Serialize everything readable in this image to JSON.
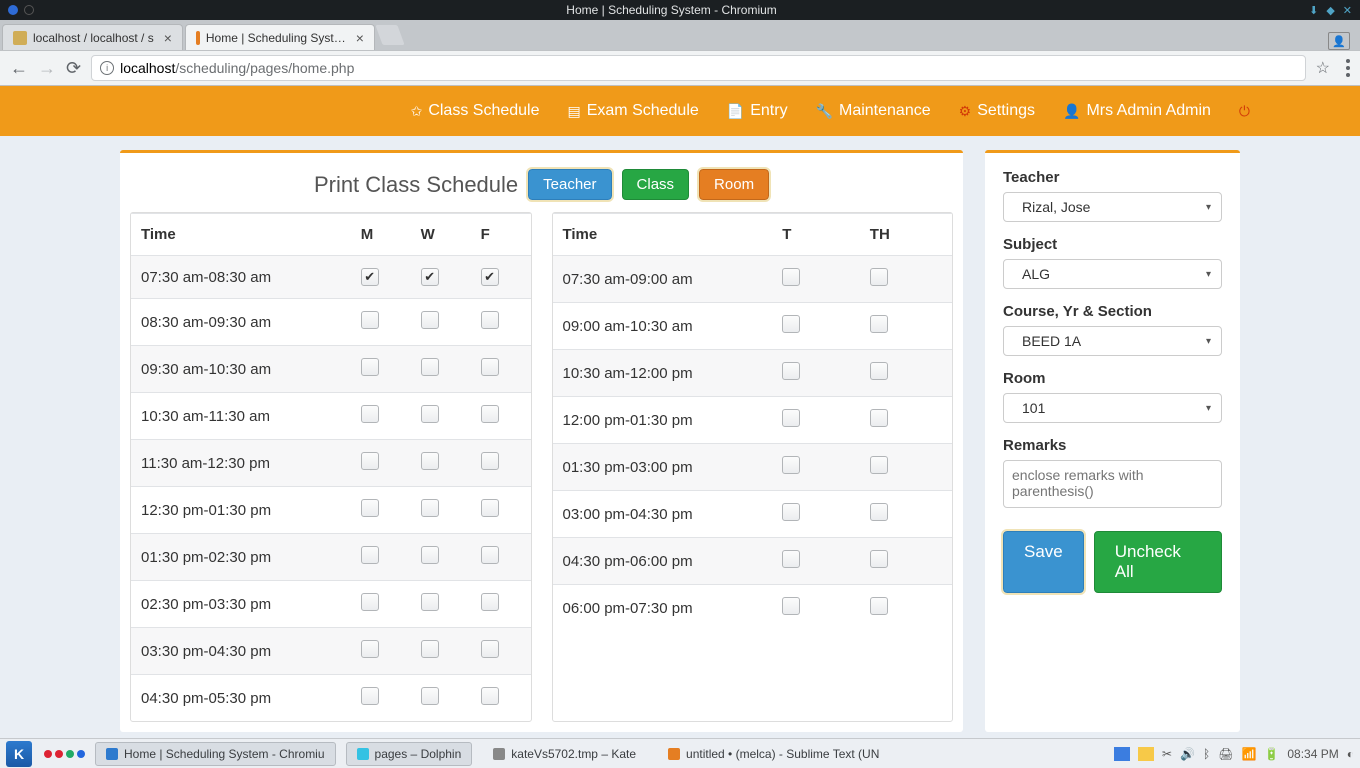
{
  "os_title": "Home | Scheduling System - Chromium",
  "browser_tabs": [
    {
      "title": "localhost / localhost / s"
    },
    {
      "title": "Home | Scheduling Syst…"
    }
  ],
  "url": {
    "host": "localhost",
    "path": "/scheduling/pages/home.php"
  },
  "nav": {
    "class_schedule": "Class Schedule",
    "exam_schedule": "Exam Schedule",
    "entry": "Entry",
    "maintenance": "Maintenance",
    "settings": "Settings",
    "user": "Mrs Admin Admin"
  },
  "page_title": "Print Class Schedule",
  "buttons": {
    "teacher": "Teacher",
    "class": "Class",
    "room": "Room"
  },
  "table_mwf": {
    "headers": [
      "Time",
      "M",
      "W",
      "F"
    ],
    "rows": [
      {
        "time": "07:30 am-08:30 am",
        "checks": [
          true,
          true,
          true
        ]
      },
      {
        "time": "08:30 am-09:30 am",
        "checks": [
          false,
          false,
          false
        ]
      },
      {
        "time": "09:30 am-10:30 am",
        "checks": [
          false,
          false,
          false
        ]
      },
      {
        "time": "10:30 am-11:30 am",
        "checks": [
          false,
          false,
          false
        ]
      },
      {
        "time": "11:30 am-12:30 pm",
        "checks": [
          false,
          false,
          false
        ]
      },
      {
        "time": "12:30 pm-01:30 pm",
        "checks": [
          false,
          false,
          false
        ]
      },
      {
        "time": "01:30 pm-02:30 pm",
        "checks": [
          false,
          false,
          false
        ]
      },
      {
        "time": "02:30 pm-03:30 pm",
        "checks": [
          false,
          false,
          false
        ]
      },
      {
        "time": "03:30 pm-04:30 pm",
        "checks": [
          false,
          false,
          false
        ]
      },
      {
        "time": "04:30 pm-05:30 pm",
        "checks": [
          false,
          false,
          false
        ]
      }
    ]
  },
  "table_tth": {
    "headers": [
      "Time",
      "T",
      "TH"
    ],
    "rows": [
      {
        "time": "07:30 am-09:00 am",
        "checks": [
          false,
          false
        ]
      },
      {
        "time": "09:00 am-10:30 am",
        "checks": [
          false,
          false
        ]
      },
      {
        "time": "10:30 am-12:00 pm",
        "checks": [
          false,
          false
        ]
      },
      {
        "time": "12:00 pm-01:30 pm",
        "checks": [
          false,
          false
        ]
      },
      {
        "time": "01:30 pm-03:00 pm",
        "checks": [
          false,
          false
        ]
      },
      {
        "time": "03:00 pm-04:30 pm",
        "checks": [
          false,
          false
        ]
      },
      {
        "time": "04:30 pm-06:00 pm",
        "checks": [
          false,
          false
        ]
      },
      {
        "time": "06:00 pm-07:30 pm",
        "checks": [
          false,
          false
        ]
      }
    ]
  },
  "form": {
    "teacher_label": "Teacher",
    "teacher_value": "Rizal, Jose",
    "subject_label": "Subject",
    "subject_value": "ALG",
    "course_label": "Course, Yr & Section",
    "course_value": "BEED 1A",
    "room_label": "Room",
    "room_value": "101",
    "remarks_label": "Remarks",
    "remarks_placeholder": "enclose remarks with parenthesis()",
    "save": "Save",
    "uncheck": "Uncheck All"
  },
  "taskbar": {
    "items": [
      "Home | Scheduling System - Chromiu",
      "pages – Dolphin",
      "kateVs5702.tmp – Kate",
      "untitled • (melca) - Sublime Text (UN"
    ],
    "clock": "08:34 PM"
  }
}
